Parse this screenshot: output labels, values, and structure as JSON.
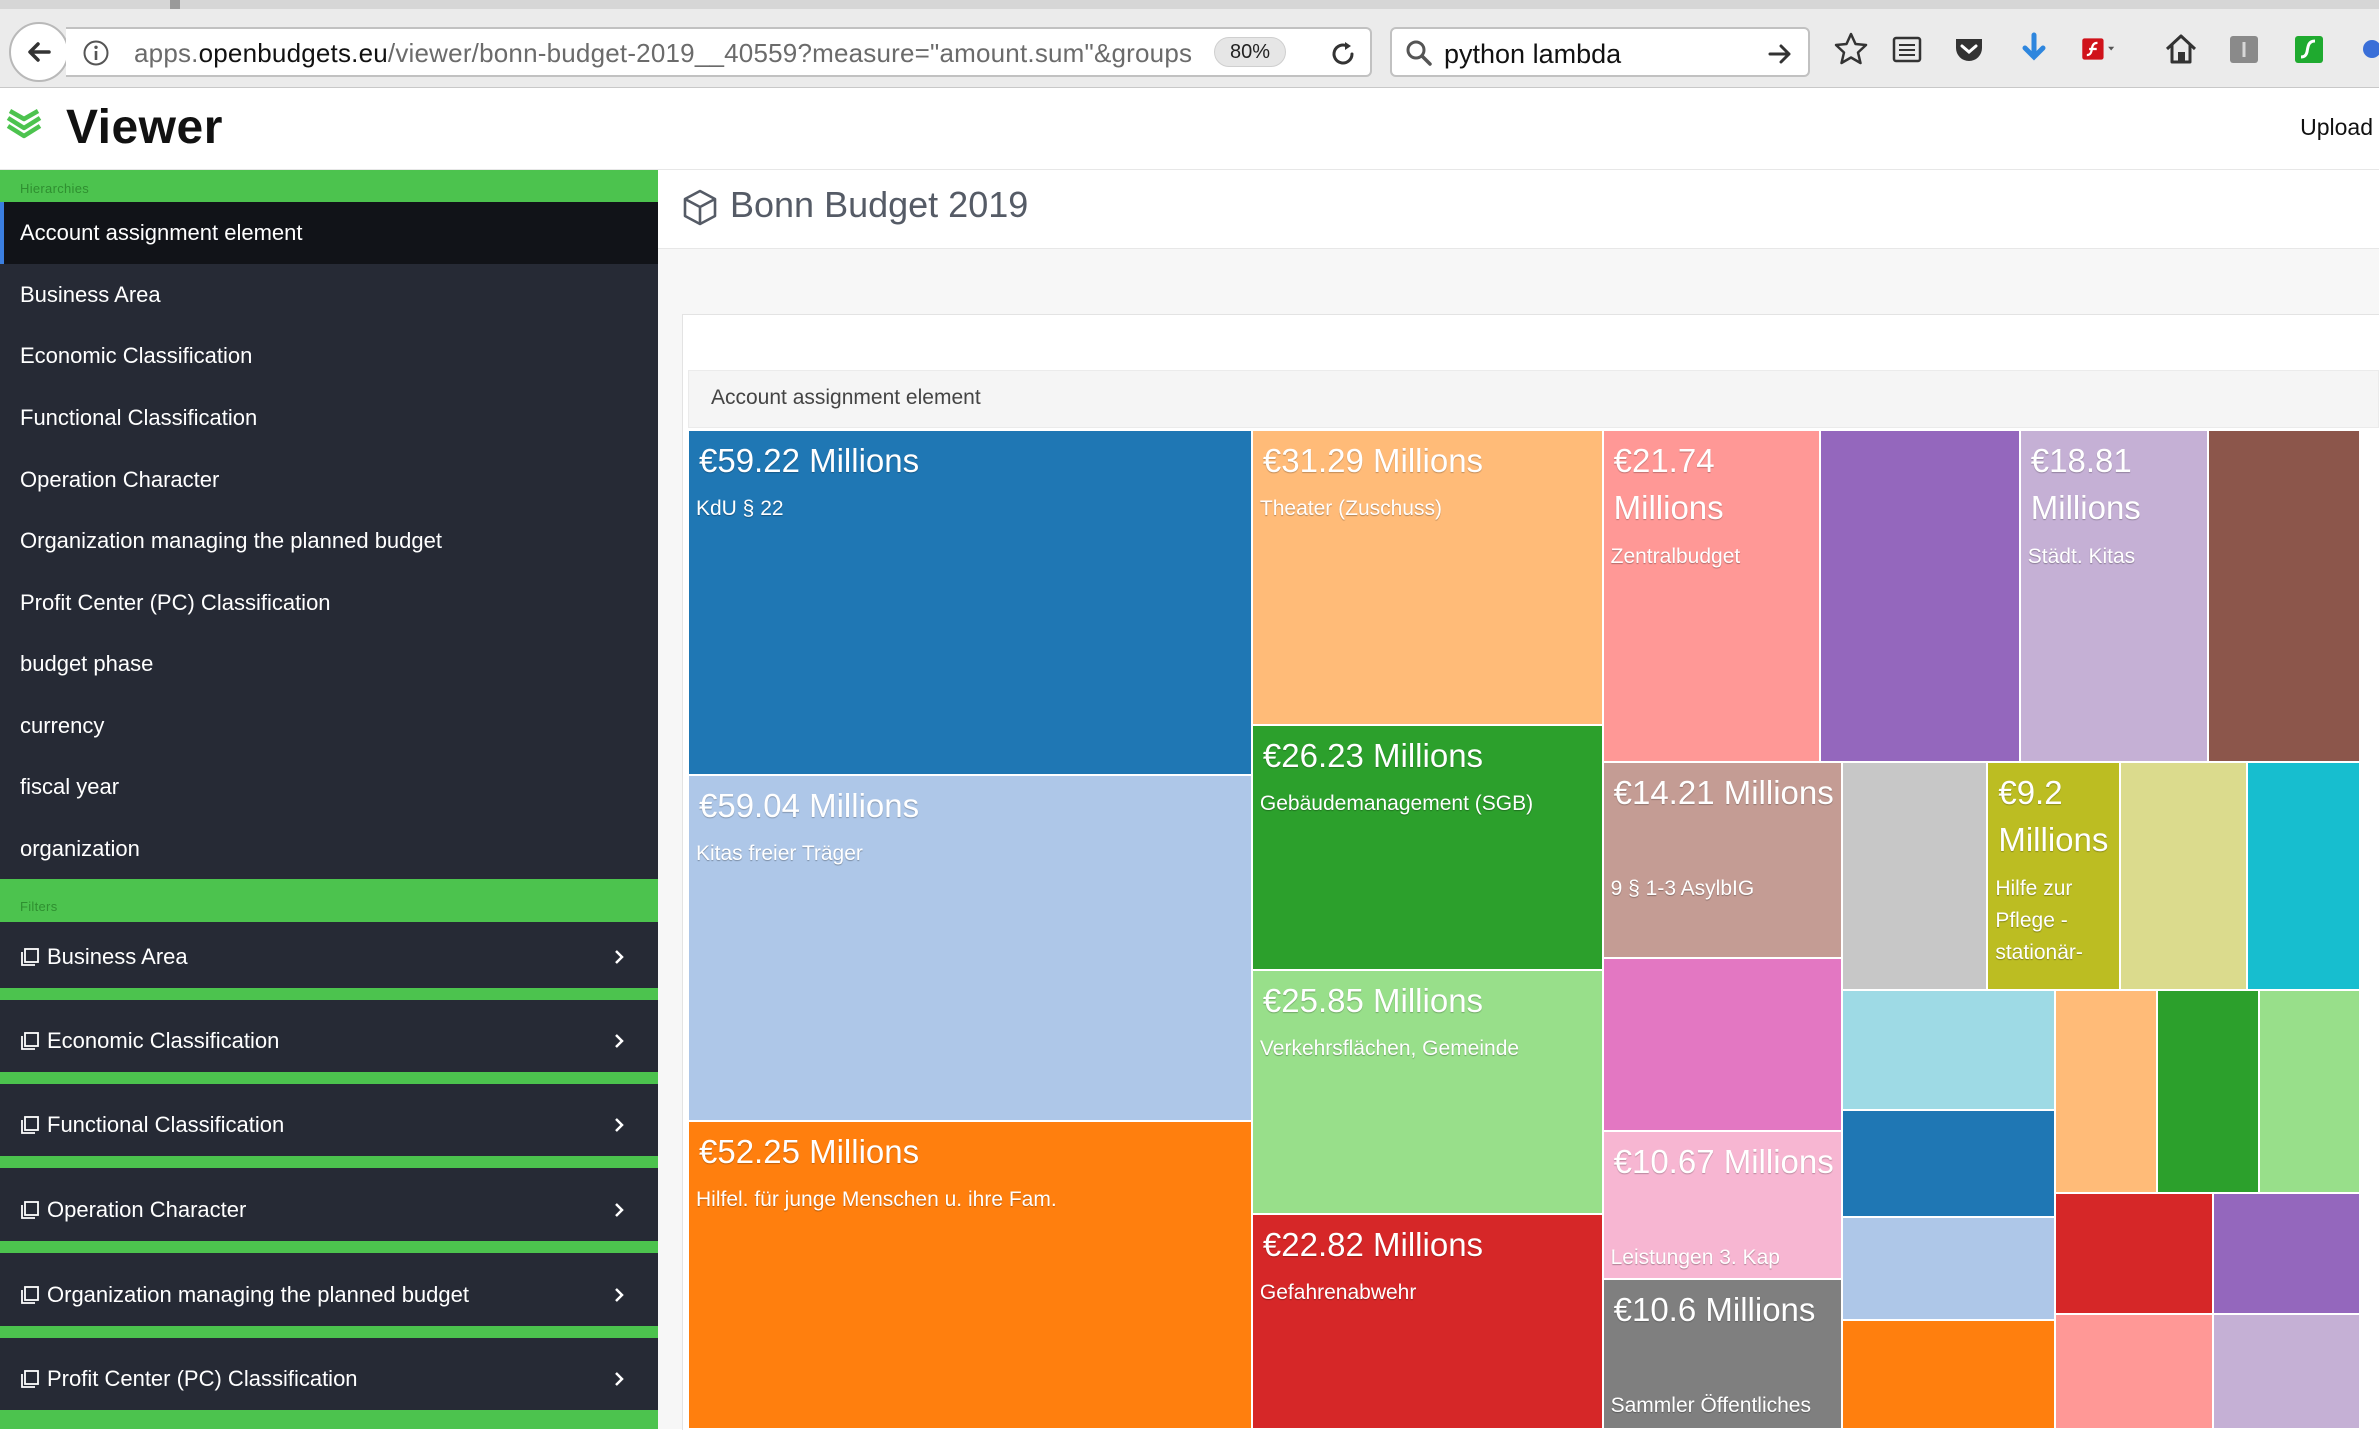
{
  "browser": {
    "url_prefix": "apps.",
    "url_domain": "openbudgets.eu",
    "url_path": "/viewer/bonn-budget-2019__40559?measure=\"amount.sum\"&groups",
    "zoom": "80%",
    "search_query": "python lambda"
  },
  "header": {
    "title": "Viewer",
    "upload_label": "Upload"
  },
  "sidebar": {
    "hierarchies_label": "Hierarchies",
    "hierarchies": [
      {
        "label": "Account assignment element",
        "active": true
      },
      {
        "label": "Business Area"
      },
      {
        "label": "Economic Classification"
      },
      {
        "label": "Functional Classification"
      },
      {
        "label": "Operation Character"
      },
      {
        "label": "Organization managing the planned budget"
      },
      {
        "label": "Profit Center (PC) Classification"
      },
      {
        "label": "budget phase"
      },
      {
        "label": "currency"
      },
      {
        "label": "fiscal year"
      },
      {
        "label": "organization"
      }
    ],
    "filters_label": "Filters",
    "filters": [
      {
        "label": "Business Area"
      },
      {
        "label": "Economic Classification"
      },
      {
        "label": "Functional Classification"
      },
      {
        "label": "Operation Character"
      },
      {
        "label": "Organization managing the planned budget"
      },
      {
        "label": "Profit Center (PC) Classification"
      }
    ]
  },
  "main": {
    "page_title": "Bonn Budget 2019",
    "panel_title": "Account assignment element"
  },
  "treemap": {
    "cells": [
      {
        "value_text": "€59.22 Millions",
        "label": "KdU § 22",
        "color": "#1f77b4"
      },
      {
        "value_text": "€59.04 Millions",
        "label": "Kitas freier Träger",
        "color": "#aec7e8"
      },
      {
        "value_text": "€52.25 Millions",
        "label": "Hilfel. für junge Menschen u. ihre Fam.",
        "color": "#ff7f0e"
      },
      {
        "value_text": "€31.29 Millions",
        "label": "Theater (Zuschuss)",
        "color": "#ffbb78"
      },
      {
        "value_text": "€26.23 Millions",
        "label": "Gebäudemanagement (SGB)",
        "color": "#2ca02c"
      },
      {
        "value_text": "€25.85 Millions",
        "label": "Verkehrsflächen, Gemeinde",
        "color": "#98df8a"
      },
      {
        "value_text": "€22.82 Millions",
        "label": "Gefahrenabwehr",
        "color": "#d62728"
      },
      {
        "value_text": "€21.74 Millions",
        "label": "Zentralbudget",
        "color": "#ff9896"
      },
      {
        "value_text": "",
        "label": "",
        "color": "#9467bd"
      },
      {
        "value_text": "€18.81 Millions",
        "label": "Städt. Kitas",
        "color": "#c5b0d5"
      },
      {
        "value_text": "",
        "label": "",
        "color": "#8c564b"
      },
      {
        "value_text": "€14.21 Millions",
        "label": "9 § 1-3 AsylbIG",
        "color": "#c49c94"
      },
      {
        "value_text": "",
        "label": "",
        "color": "#c7c7c7"
      },
      {
        "value_text": "€9.2 Millions",
        "label": "Hilfe zur Pflege -stationär-",
        "color": "#bcbd22"
      },
      {
        "value_text": "",
        "label": "",
        "color": "#dbdb8d"
      },
      {
        "value_text": "",
        "label": "",
        "color": "#17becf"
      },
      {
        "value_text": "",
        "label": "",
        "color": "#e377c2"
      },
      {
        "value_text": "",
        "label": "",
        "color": "#9edae5"
      },
      {
        "value_text": "",
        "label": "",
        "color": "#ffbb78"
      },
      {
        "value_text": "",
        "label": "",
        "color": "#2ca02c"
      },
      {
        "value_text": "",
        "label": "",
        "color": "#98df8a"
      },
      {
        "value_text": "€10.67 Millions",
        "label": "Leistungen 3. Kap",
        "color": "#f7b6d2"
      },
      {
        "value_text": "",
        "label": "",
        "color": "#1f77b4"
      },
      {
        "value_text": "",
        "label": "",
        "color": "#aec7e8"
      },
      {
        "value_text": "",
        "label": "",
        "color": "#d62728"
      },
      {
        "value_text": "",
        "label": "",
        "color": "#9467bd"
      },
      {
        "value_text": "€10.6 Millions",
        "label": "Sammler Öffentliches Grün",
        "color": "#7f7f7f"
      },
      {
        "value_text": "",
        "label": "",
        "color": "#ff7f0e"
      },
      {
        "value_text": "",
        "label": "",
        "color": "#ff9896"
      },
      {
        "value_text": "",
        "label": "",
        "color": "#c5b0d5"
      }
    ]
  }
}
